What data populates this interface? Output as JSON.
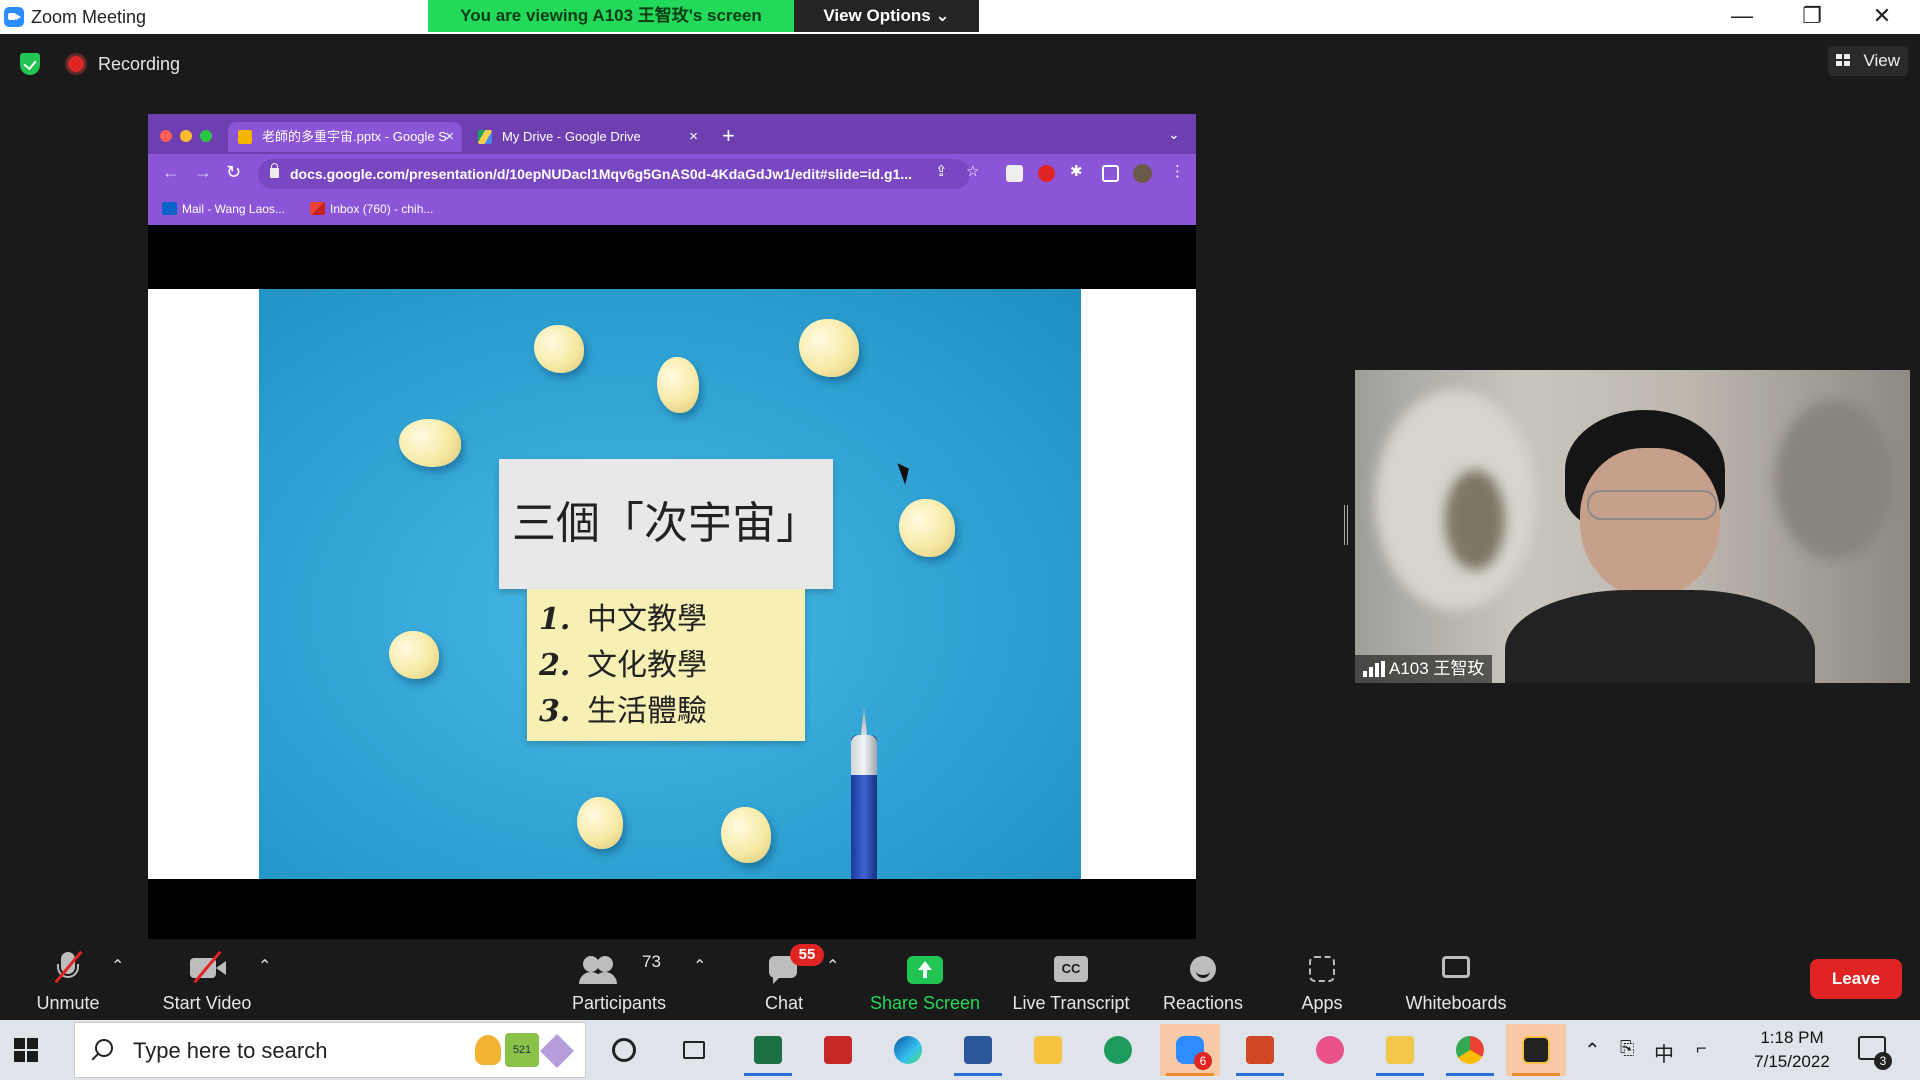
{
  "window": {
    "title": "Zoom Meeting",
    "viewing_banner": "You are viewing A103 王智玫's screen",
    "view_options": "View Options ⌄",
    "controls": {
      "minimize": "—",
      "restore": "❐",
      "close": "✕"
    }
  },
  "status_bar": {
    "recording": "Recording",
    "view_label": "View"
  },
  "shared_screen": {
    "browser": {
      "tabs": [
        {
          "label": "老師的多重宇宙.pptx - Google S",
          "active": true
        },
        {
          "label": "My Drive - Google Drive",
          "active": false
        }
      ],
      "url": "docs.google.com/presentation/d/10epNUDacl1Mqv6g5GnAS0d-4KdaGdJw1/edit#slide=id.g1...",
      "bookmarks": [
        {
          "label": "Mail - Wang Laos..."
        },
        {
          "label": "Inbox (760) - chih..."
        }
      ]
    },
    "slide": {
      "title": "三個「次宇宙」",
      "items": [
        {
          "num": "1.",
          "text": "中文教學"
        },
        {
          "num": "2.",
          "text": "文化教學"
        },
        {
          "num": "3.",
          "text": "生活體驗"
        }
      ]
    }
  },
  "participant_video": {
    "name": "A103 王智玫"
  },
  "toolbar": {
    "unmute": "Unmute",
    "start_video": "Start Video",
    "participants": "Participants",
    "participants_count": "73",
    "chat": "Chat",
    "chat_badge": "55",
    "share_screen": "Share Screen",
    "live_transcript": "Live Transcript",
    "cc": "CC",
    "reactions": "Reactions",
    "apps": "Apps",
    "whiteboards": "Whiteboards",
    "leave": "Leave"
  },
  "taskbar": {
    "search_placeholder": "Type here to search",
    "search_deco_badge": "521",
    "zoom_badge": "6",
    "time": "1:18 PM",
    "date": "7/15/2022",
    "ime": "中",
    "notifications": "3"
  },
  "colors": {
    "zoom_blue": "#2d8cff",
    "banner_green": "#23d959",
    "leave_red": "#e02424",
    "browser_purple": "#6d3fb0"
  }
}
